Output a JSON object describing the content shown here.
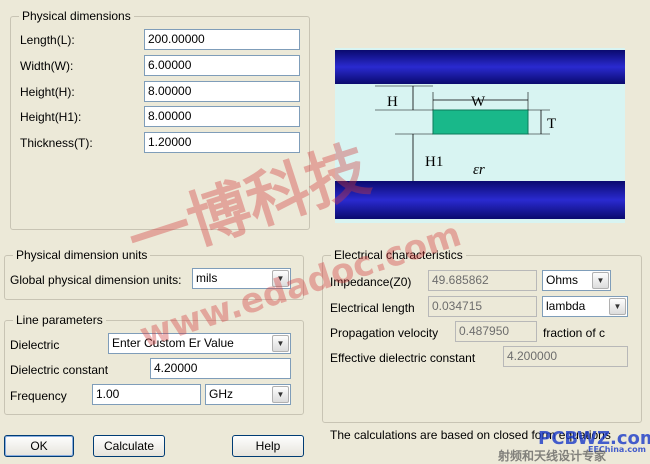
{
  "physical_dimensions": {
    "title": "Physical dimensions",
    "fields": [
      {
        "label": "Length(L):",
        "value": "200.00000"
      },
      {
        "label": "Width(W):",
        "value": "6.00000"
      },
      {
        "label": "Height(H):",
        "value": "8.00000"
      },
      {
        "label": "Height(H1):",
        "value": "8.00000"
      },
      {
        "label": "Thickness(T):",
        "value": "1.20000"
      }
    ]
  },
  "diagram": {
    "label_h": "H",
    "label_w": "W",
    "label_t": "T",
    "label_h1": "H1",
    "label_er": "εr",
    "colors": {
      "ground": "#1a1aa0",
      "dielectric": "#d8f4f2",
      "strip": "#19b88a"
    }
  },
  "units": {
    "title": "Physical dimension units",
    "label": "Global physical dimension units:",
    "value": "mils"
  },
  "line_parameters": {
    "title": "Line parameters",
    "dielectric_label": "Dielectric",
    "dielectric_value": "Enter Custom Er Value",
    "dielectric_constant_label": "Dielectric constant",
    "dielectric_constant_value": "4.20000",
    "frequency_label": "Frequency",
    "frequency_value": "1.00",
    "frequency_unit": "GHz"
  },
  "electrical": {
    "title": "Electrical characteristics",
    "impedance_label": "Impedance(Z0)",
    "impedance_value": "49.685862",
    "impedance_unit": "Ohms",
    "length_label": "Electrical length",
    "length_value": "0.034715",
    "length_unit": "lambda",
    "velocity_label": "Propagation velocity",
    "velocity_value": "0.487950",
    "velocity_unit": "fraction of c",
    "eff_label": "Effective dielectric constant",
    "eff_value": "4.200000",
    "note": "The calculations are based on closed form equations"
  },
  "buttons": {
    "ok": "OK",
    "calculate": "Calculate",
    "help": "Help"
  },
  "watermarks": {
    "main": "一博科技",
    "url": "www.edadoc.com",
    "logo": "PCBWZ.com",
    "logo_sub": "EEChina.com",
    "footer": "射频和天线设计专家"
  }
}
